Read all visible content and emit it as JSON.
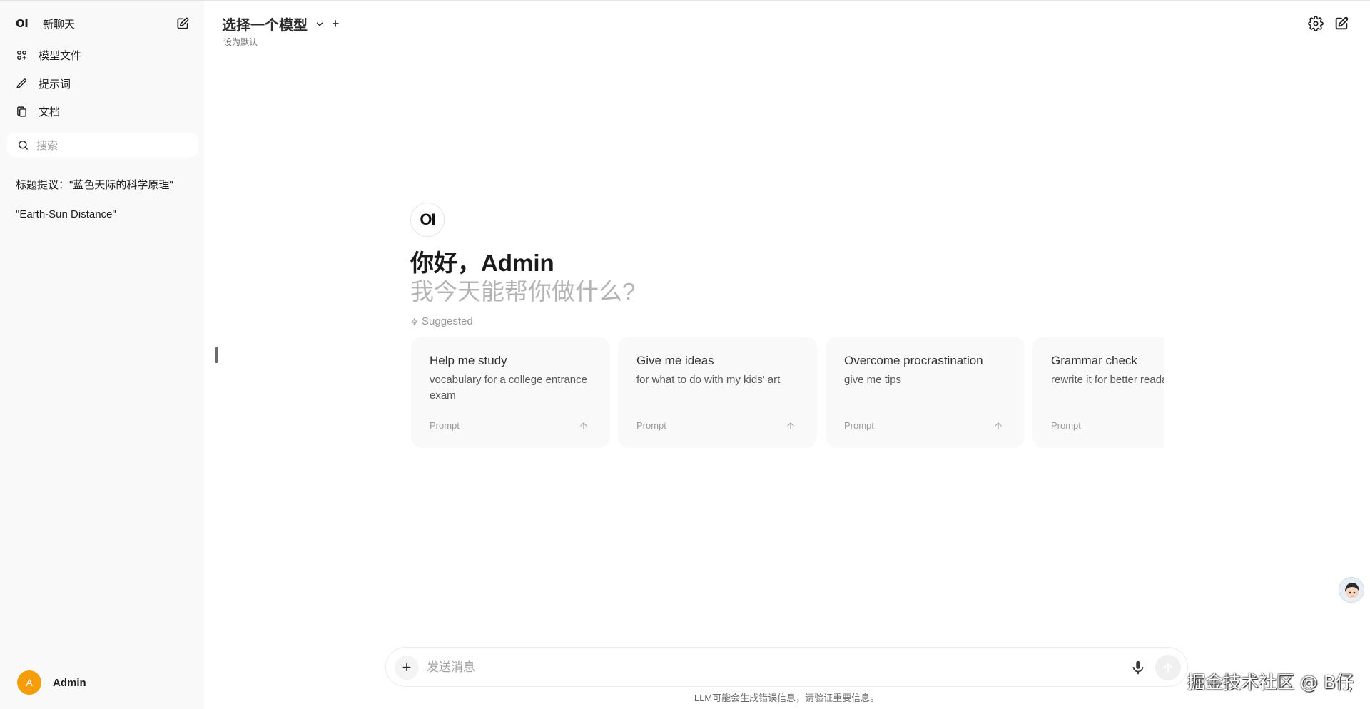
{
  "sidebar": {
    "brand": "OI",
    "new_chat": "新聊天",
    "nav": [
      {
        "label": "模型文件",
        "icon": "models-icon"
      },
      {
        "label": "提示词",
        "icon": "pencil-icon"
      },
      {
        "label": "文档",
        "icon": "documents-icon"
      }
    ],
    "search_placeholder": "搜索",
    "history": [
      "标题提议：\"蓝色天际的科学原理\"",
      "\"Earth-Sun Distance\""
    ],
    "user": {
      "initial": "A",
      "name": "Admin",
      "avatar_color": "#f59e0b"
    }
  },
  "header": {
    "model_select": "选择一个模型",
    "add": "+",
    "set_default": "设为默认"
  },
  "welcome": {
    "logo": "OI",
    "greeting": "你好，Admin",
    "subtitle": "我今天能帮你做什么?",
    "suggested_label": "Suggested"
  },
  "suggestions": [
    {
      "title": "Help me study",
      "subtitle": "vocabulary for a college entrance exam",
      "tag": "Prompt"
    },
    {
      "title": "Give me ideas",
      "subtitle": "for what to do with my kids' art",
      "tag": "Prompt"
    },
    {
      "title": "Overcome procrastination",
      "subtitle": "give me tips",
      "tag": "Prompt"
    },
    {
      "title": "Grammar check",
      "subtitle": "rewrite it for better readability",
      "tag": "Prompt"
    }
  ],
  "composer": {
    "placeholder": "发送消息",
    "add": "+",
    "disclaimer": "LLM可能会生成错误信息，请验证重要信息。"
  },
  "watermark": "掘金技术社区 @ B仔",
  "help": "?"
}
